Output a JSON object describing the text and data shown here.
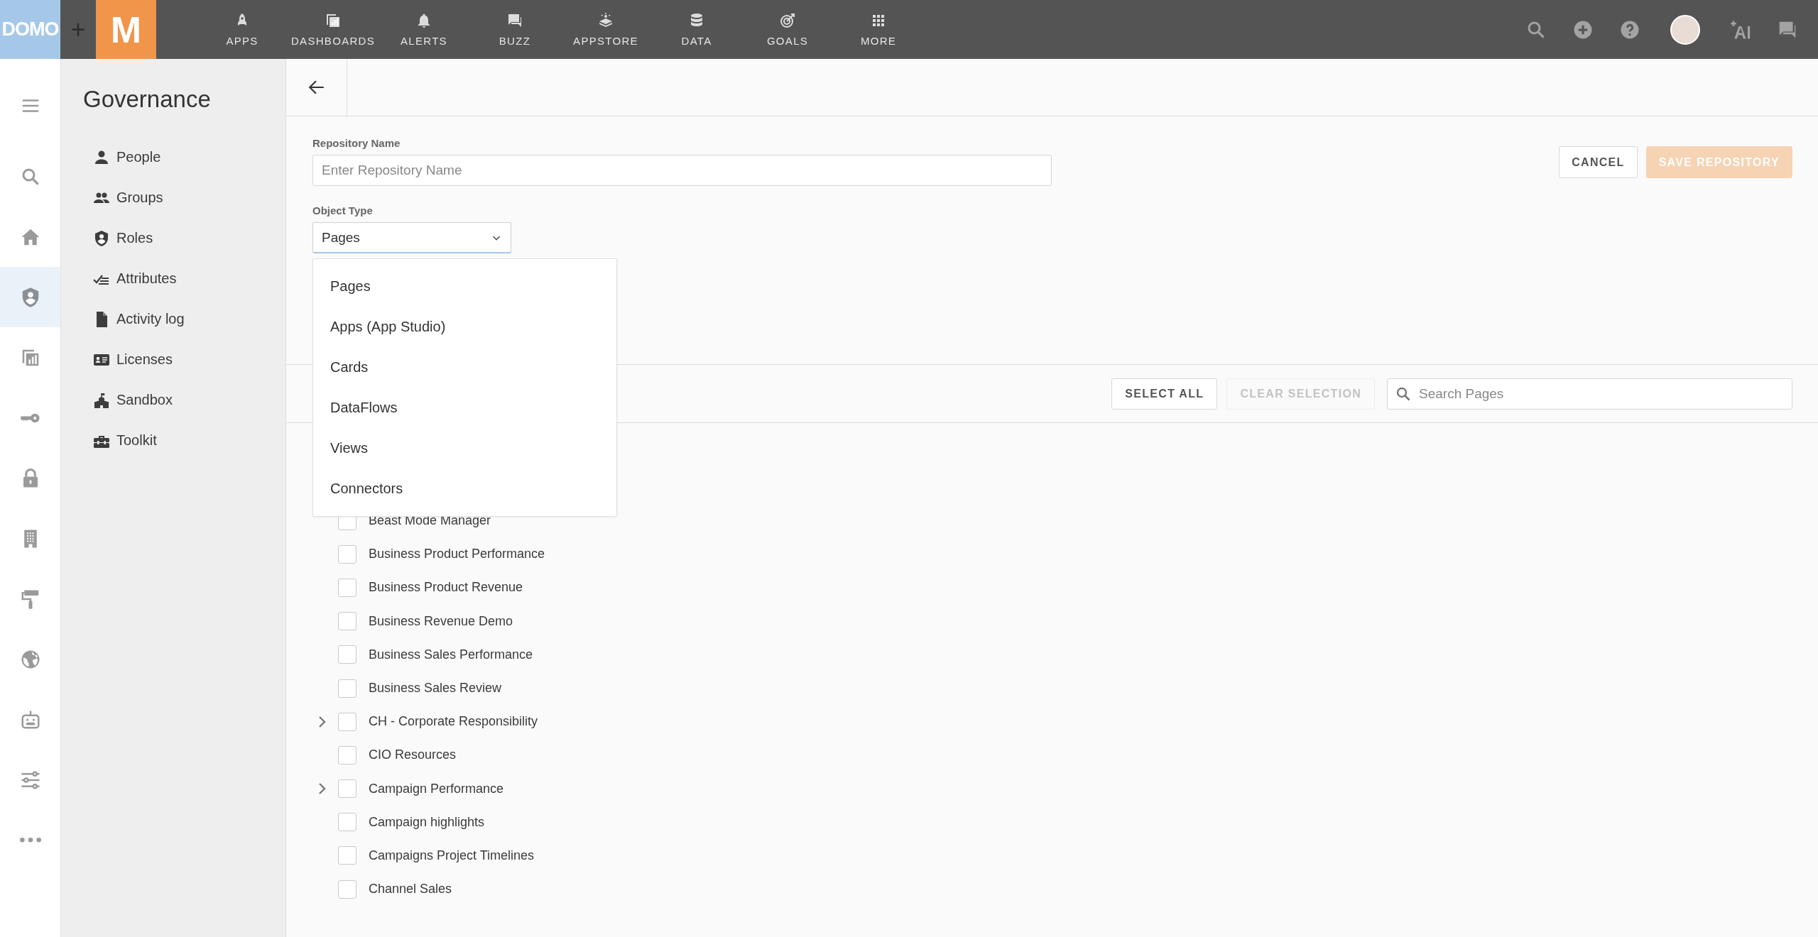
{
  "top_bar": {
    "logo": "DOMO",
    "add": "+",
    "brand_mark": "M",
    "nav": [
      {
        "label": "APPS",
        "kind": "rocket"
      },
      {
        "label": "DASHBOARDS",
        "kind": "dashboard"
      },
      {
        "label": "ALERTS",
        "kind": "bell"
      },
      {
        "label": "BUZZ",
        "kind": "chat"
      },
      {
        "label": "APPSTORE",
        "kind": "store"
      },
      {
        "label": "DATA",
        "kind": "database"
      },
      {
        "label": "GOALS",
        "kind": "target"
      },
      {
        "label": "MORE",
        "kind": "grid"
      }
    ],
    "actions": [
      {
        "kind": "search"
      },
      {
        "kind": "plus"
      },
      {
        "kind": "help"
      },
      {
        "kind": "avatar"
      },
      {
        "kind": "ai"
      },
      {
        "kind": "chat"
      }
    ]
  },
  "rail": [
    {
      "kind": "menu",
      "selected": false
    },
    {
      "kind": "search",
      "selected": false
    },
    {
      "kind": "home",
      "selected": false
    },
    {
      "kind": "shield",
      "selected": true
    },
    {
      "kind": "dashboard",
      "selected": false
    },
    {
      "kind": "key",
      "selected": false
    },
    {
      "kind": "lock",
      "selected": false
    },
    {
      "kind": "building",
      "selected": false
    },
    {
      "kind": "roller",
      "selected": false
    },
    {
      "kind": "globe",
      "selected": false
    },
    {
      "kind": "robot",
      "selected": false
    },
    {
      "kind": "sliders",
      "selected": false
    },
    {
      "kind": "dots",
      "selected": false
    }
  ],
  "sidebar": {
    "title": "Governance",
    "items": [
      {
        "label": "People",
        "kind": "person"
      },
      {
        "label": "Groups",
        "kind": "group"
      },
      {
        "label": "Roles",
        "kind": "shield"
      },
      {
        "label": "Attributes",
        "kind": "attributes"
      },
      {
        "label": "Activity log",
        "kind": "file"
      },
      {
        "label": "Licenses",
        "kind": "card"
      },
      {
        "label": "Sandbox",
        "kind": "castle"
      },
      {
        "label": "Toolkit",
        "kind": "toolbox"
      }
    ]
  },
  "form": {
    "name_label": "Repository Name",
    "name_placeholder": "Enter Repository Name",
    "type_label": "Object Type",
    "type_value": "Pages",
    "expanded": true,
    "options": [
      {
        "label": "Pages"
      },
      {
        "label": "Apps (App Studio)"
      },
      {
        "label": "Cards"
      },
      {
        "label": "DataFlows"
      },
      {
        "label": "Views"
      },
      {
        "label": "Connectors"
      }
    ],
    "buttons": [
      {
        "label": "CANCEL",
        "kind": "secondary",
        "disabled": false
      },
      {
        "label": "SAVE REPOSITORY",
        "kind": "primary",
        "disabled": true
      }
    ]
  },
  "toolbar": {
    "buttons": [
      {
        "label": "SELECT ALL",
        "disabled": false
      },
      {
        "label": "CLEAR SELECTION",
        "disabled": true
      }
    ],
    "search": {
      "placeholder": "Search Pages"
    }
  },
  "rows": [
    {
      "label": "Beast Mode Manager",
      "expandable": false,
      "checked": false
    },
    {
      "label": "Business Product Performance",
      "expandable": false,
      "checked": false
    },
    {
      "label": "Business Product Revenue",
      "expandable": false,
      "checked": false
    },
    {
      "label": "Business Revenue Demo",
      "expandable": false,
      "checked": false
    },
    {
      "label": "Business Sales Performance",
      "expandable": false,
      "checked": false
    },
    {
      "label": "Business Sales Review",
      "expandable": false,
      "checked": false
    },
    {
      "label": "CH - Corporate Responsibility",
      "expandable": true,
      "checked": false
    },
    {
      "label": "CIO Resources",
      "expandable": false,
      "checked": false
    },
    {
      "label": "Campaign Performance",
      "expandable": true,
      "checked": false
    },
    {
      "label": "Campaign highlights",
      "expandable": false,
      "checked": false
    },
    {
      "label": "Campaigns Project Timelines",
      "expandable": false,
      "checked": false
    },
    {
      "label": "Channel Sales",
      "expandable": false,
      "checked": false
    }
  ]
}
